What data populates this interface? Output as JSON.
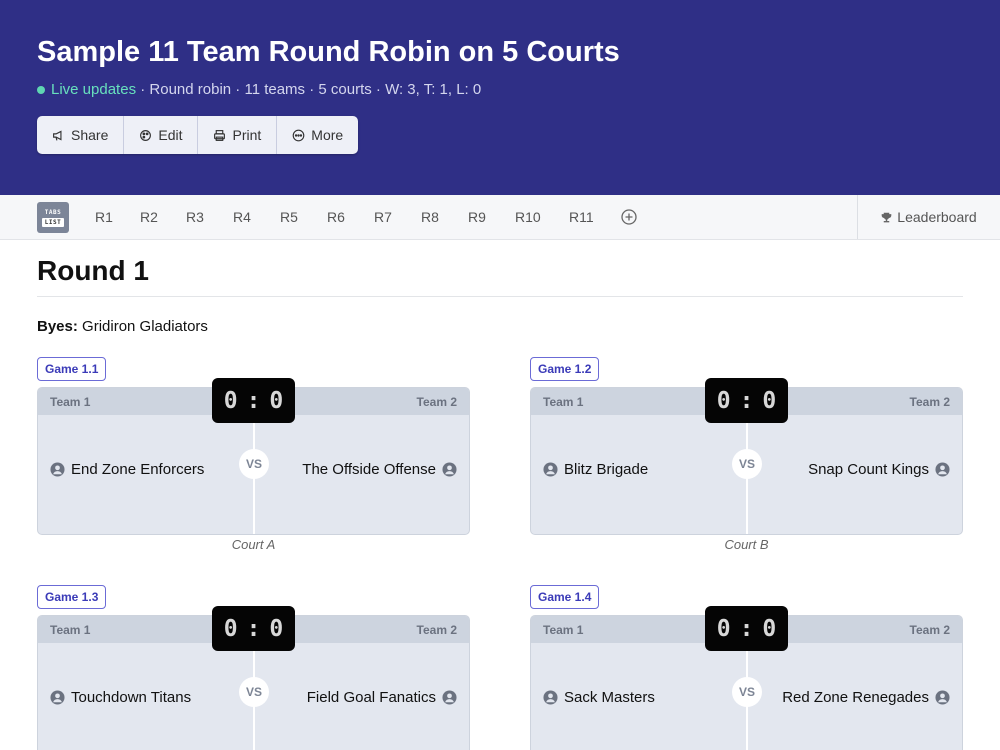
{
  "header": {
    "title": "Sample 11 Team Round Robin on 5 Courts",
    "live_label": "Live updates",
    "meta_rest": " · Round robin · 11 teams · 5 courts · W: 3, T: 1, L: 0",
    "actions": [
      {
        "label": "Share",
        "icon": "megaphone-icon"
      },
      {
        "label": "Edit",
        "icon": "palette-icon"
      },
      {
        "label": "Print",
        "icon": "printer-icon"
      },
      {
        "label": "More",
        "icon": "more-icon"
      }
    ]
  },
  "tabs": {
    "tabs_list_top": "TABS",
    "tabs_list_bottom": "LIST",
    "rounds": [
      "R1",
      "R2",
      "R3",
      "R4",
      "R5",
      "R6",
      "R7",
      "R8",
      "R9",
      "R10",
      "R11"
    ],
    "leaderboard": "Leaderboard"
  },
  "round": {
    "title": "Round 1",
    "byes_label": "Byes:",
    "byes_value": " Gridiron Gladiators",
    "games": [
      {
        "badge": "Game 1.1",
        "team1_label": "Team 1",
        "team2_label": "Team 2",
        "score1": "0",
        "score2": "0",
        "team1": "End Zone Enforcers",
        "team2": "The Offside Offense",
        "vs": "VS",
        "court": "Court A"
      },
      {
        "badge": "Game 1.2",
        "team1_label": "Team 1",
        "team2_label": "Team 2",
        "score1": "0",
        "score2": "0",
        "team1": "Blitz Brigade",
        "team2": "Snap Count Kings",
        "vs": "VS",
        "court": "Court B"
      },
      {
        "badge": "Game 1.3",
        "team1_label": "Team 1",
        "team2_label": "Team 2",
        "score1": "0",
        "score2": "0",
        "team1": "Touchdown Titans",
        "team2": "Field Goal Fanatics",
        "vs": "VS",
        "court": ""
      },
      {
        "badge": "Game 1.4",
        "team1_label": "Team 1",
        "team2_label": "Team 2",
        "score1": "0",
        "score2": "0",
        "team1": "Sack Masters",
        "team2": "Red Zone Renegades",
        "vs": "VS",
        "court": ""
      }
    ]
  },
  "colors": {
    "header_bg": "#2f2f86",
    "live_green": "#68e0bd",
    "accent": "#3b3bb8",
    "scoreboard": "#050505"
  }
}
